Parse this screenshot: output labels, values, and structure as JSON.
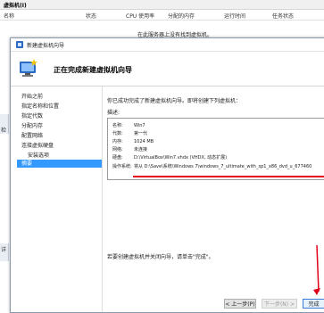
{
  "background": {
    "title": "虚拟机(I)",
    "columns": [
      "名称",
      "状态",
      "CPU 使用率",
      "分配的内存",
      "运行时间",
      "任务状态"
    ],
    "empty_message": "在此服务器上没有找到虚拟机。",
    "left_labels": [
      "检",
      "详"
    ]
  },
  "dialog": {
    "window_title": "新建虚拟机向导",
    "heading": "正在完成新建虚拟机向导",
    "nav_items": [
      {
        "label": "开始之前"
      },
      {
        "label": "指定名称和位置"
      },
      {
        "label": "指定代数"
      },
      {
        "label": "分配内存"
      },
      {
        "label": "配置网络"
      },
      {
        "label": "连接虚拟硬盘"
      },
      {
        "label": "安装选项"
      },
      {
        "label": "摘要"
      }
    ],
    "intro": "你已成功完成了新建虚拟机向导。即将创建下列虚拟机：",
    "desc_label": "描述:",
    "summary": [
      {
        "key": "名称:",
        "value": "Win7"
      },
      {
        "key": "代数:",
        "value": "第一代"
      },
      {
        "key": "内存:",
        "value": "1024 MB"
      },
      {
        "key": "网络:",
        "value": "未连接"
      },
      {
        "key": "硬盘:",
        "value": "D:\\VirtualBox\\Win7.vhdx (VHDX, 动态扩展)"
      },
      {
        "key": "操作系统:",
        "value": "将从 D:\\Save\\系统\\Windows 7\\windows_7_ultimate_with_sp1_x86_dvd_u_677460"
      }
    ],
    "finish_note": "若要创建虚拟机并关闭向导，请单击\"完成\"。",
    "buttons": {
      "prev": "< 上一步(P)",
      "next": "下一步(N) >",
      "finish": "完成"
    }
  },
  "colors": {
    "selected": "#3399ff",
    "highlight": "#e3001b",
    "icon_blue": "#2b6cc2"
  }
}
